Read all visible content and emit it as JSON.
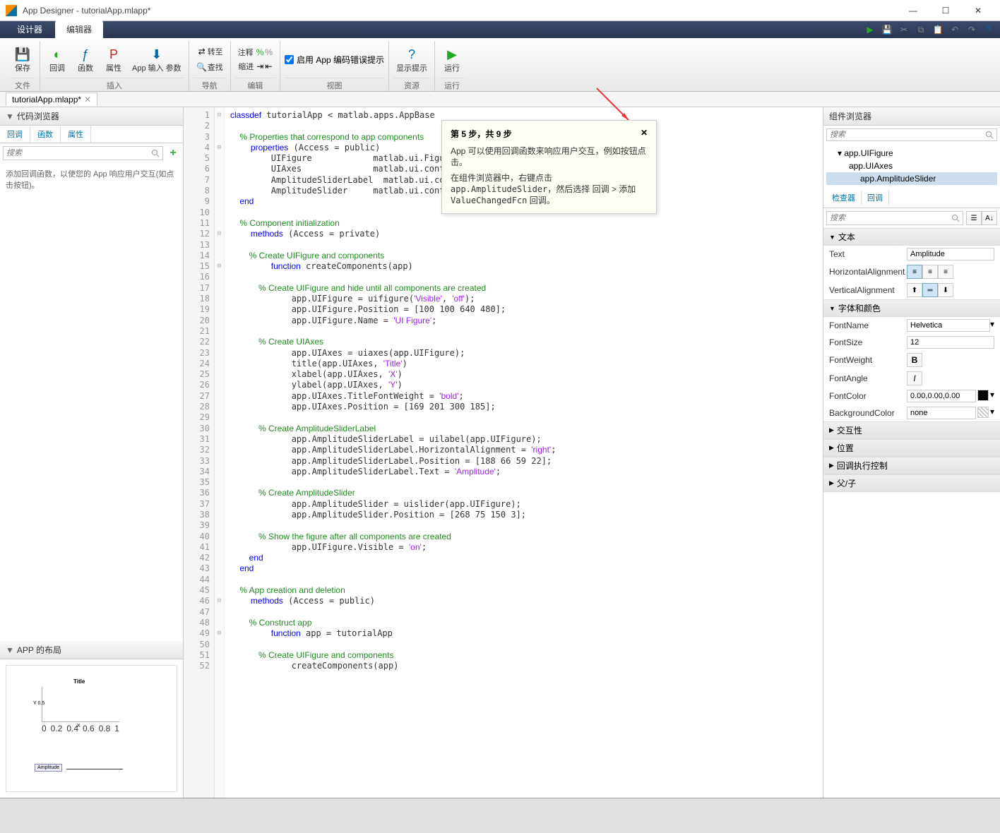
{
  "window": {
    "title": "App Designer - tutorialApp.mlapp*"
  },
  "tabs": {
    "designer": "设计器",
    "editor": "编辑器"
  },
  "ribbon": {
    "save": "保存",
    "callback": "回调",
    "function": "函数",
    "property": "属性",
    "appinput": "App 输入\n参数",
    "goto": "转至",
    "comment": "注释",
    "find": "查找",
    "indent": "缩进",
    "enable_hints": "启用 App 编码错误提示",
    "show_hints": "显示提示",
    "run": "运行",
    "grp_file": "文件",
    "grp_insert": "插入",
    "grp_nav": "导航",
    "grp_edit": "编辑",
    "grp_view": "视图",
    "grp_res": "资源",
    "grp_run": "运行"
  },
  "filetab": "tutorialApp.mlapp*",
  "left": {
    "browser_title": "代码浏览器",
    "tabs": {
      "callback": "回调",
      "function": "函数",
      "property": "属性"
    },
    "search": "搜索",
    "hint": "添加回调函数，以使您的 App 响应用户交互(如点击按钮)。",
    "layout_title": "APP 的布局",
    "mini": {
      "title": "Title",
      "ylabel": "Y 0.5",
      "xlabel": "X",
      "amplitude": "Amplitude",
      "ticks": [
        "0",
        "0.2",
        "0.4",
        "0.6",
        "0.8",
        "1"
      ]
    }
  },
  "code_lines": [
    {
      "n": 1,
      "t": "classdef tutorialApp < matlab.apps.AppBase",
      "cls": ""
    },
    {
      "n": 2,
      "t": "",
      "cls": ""
    },
    {
      "n": 3,
      "t": "    % Properties that correspond to app components",
      "cls": "cmt"
    },
    {
      "n": 4,
      "t": "    properties (Access = public)",
      "cls": ""
    },
    {
      "n": 5,
      "t": "        UIFigure            matlab.ui.Figure",
      "cls": ""
    },
    {
      "n": 6,
      "t": "        UIAxes              matlab.ui.control.UIAxes",
      "cls": ""
    },
    {
      "n": 7,
      "t": "        AmplitudeSliderLabel  matlab.ui.control.Label",
      "cls": ""
    },
    {
      "n": 8,
      "t": "        AmplitudeSlider     matlab.ui.control.Slider",
      "cls": ""
    },
    {
      "n": 9,
      "t": "    end",
      "cls": "kw"
    },
    {
      "n": 10,
      "t": "",
      "cls": ""
    },
    {
      "n": 11,
      "t": "    % Component initialization",
      "cls": "cmt"
    },
    {
      "n": 12,
      "t": "    methods (Access = private)",
      "cls": ""
    },
    {
      "n": 13,
      "t": "",
      "cls": ""
    },
    {
      "n": 14,
      "t": "        % Create UIFigure and components",
      "cls": "cmt"
    },
    {
      "n": 15,
      "t": "        function createComponents(app)",
      "cls": ""
    },
    {
      "n": 16,
      "t": "",
      "cls": ""
    },
    {
      "n": 17,
      "t": "            % Create UIFigure and hide until all components are created",
      "cls": "cmt"
    },
    {
      "n": 18,
      "t": "            app.UIFigure = uifigure('Visible', 'off');",
      "cls": ""
    },
    {
      "n": 19,
      "t": "            app.UIFigure.Position = [100 100 640 480];",
      "cls": ""
    },
    {
      "n": 20,
      "t": "            app.UIFigure.Name = 'UI Figure';",
      "cls": ""
    },
    {
      "n": 21,
      "t": "",
      "cls": ""
    },
    {
      "n": 22,
      "t": "            % Create UIAxes",
      "cls": "cmt"
    },
    {
      "n": 23,
      "t": "            app.UIAxes = uiaxes(app.UIFigure);",
      "cls": ""
    },
    {
      "n": 24,
      "t": "            title(app.UIAxes, 'Title')",
      "cls": ""
    },
    {
      "n": 25,
      "t": "            xlabel(app.UIAxes, 'X')",
      "cls": ""
    },
    {
      "n": 26,
      "t": "            ylabel(app.UIAxes, 'Y')",
      "cls": ""
    },
    {
      "n": 27,
      "t": "            app.UIAxes.TitleFontWeight = 'bold';",
      "cls": ""
    },
    {
      "n": 28,
      "t": "            app.UIAxes.Position = [169 201 300 185];",
      "cls": ""
    },
    {
      "n": 29,
      "t": "",
      "cls": ""
    },
    {
      "n": 30,
      "t": "            % Create AmplitudeSliderLabel",
      "cls": "cmt"
    },
    {
      "n": 31,
      "t": "            app.AmplitudeSliderLabel = uilabel(app.UIFigure);",
      "cls": ""
    },
    {
      "n": 32,
      "t": "            app.AmplitudeSliderLabel.HorizontalAlignment = 'right';",
      "cls": ""
    },
    {
      "n": 33,
      "t": "            app.AmplitudeSliderLabel.Position = [188 66 59 22];",
      "cls": ""
    },
    {
      "n": 34,
      "t": "            app.AmplitudeSliderLabel.Text = 'Amplitude';",
      "cls": ""
    },
    {
      "n": 35,
      "t": "",
      "cls": ""
    },
    {
      "n": 36,
      "t": "            % Create AmplitudeSlider",
      "cls": "cmt"
    },
    {
      "n": 37,
      "t": "            app.AmplitudeSlider = uislider(app.UIFigure);",
      "cls": ""
    },
    {
      "n": 38,
      "t": "            app.AmplitudeSlider.Position = [268 75 150 3];",
      "cls": ""
    },
    {
      "n": 39,
      "t": "",
      "cls": ""
    },
    {
      "n": 40,
      "t": "            % Show the figure after all components are created",
      "cls": "cmt"
    },
    {
      "n": 41,
      "t": "            app.UIFigure.Visible = 'on';",
      "cls": ""
    },
    {
      "n": 42,
      "t": "        end",
      "cls": "kw"
    },
    {
      "n": 43,
      "t": "    end",
      "cls": "kw"
    },
    {
      "n": 44,
      "t": "",
      "cls": ""
    },
    {
      "n": 45,
      "t": "    % App creation and deletion",
      "cls": "cmt"
    },
    {
      "n": 46,
      "t": "    methods (Access = public)",
      "cls": ""
    },
    {
      "n": 47,
      "t": "",
      "cls": ""
    },
    {
      "n": 48,
      "t": "        % Construct app",
      "cls": "cmt"
    },
    {
      "n": 49,
      "t": "        function app = tutorialApp",
      "cls": ""
    },
    {
      "n": 50,
      "t": "",
      "cls": ""
    },
    {
      "n": 51,
      "t": "            % Create UIFigure and components",
      "cls": "cmt"
    },
    {
      "n": 52,
      "t": "            createComponents(app)",
      "cls": ""
    }
  ],
  "tooltip": {
    "step": "第 5 步，共 9 步",
    "body1": "App 可以使用回调函数来响应用户交互，例如按钮点击。",
    "body2a": "在组件浏览器中，右键点击 ",
    "body2b": "app.AmplitudeSlider",
    "body2c": "，然后选择 回调 > 添加 ",
    "body2d": "ValueChangedFcn",
    "body2e": " 回调。"
  },
  "right": {
    "browser_title": "组件浏览器",
    "search": "搜索",
    "tree": {
      "fig": "app.UIFigure",
      "axes": "app.UIAxes",
      "slider": "app.AmplitudeSlider"
    },
    "inspector": "检查器",
    "callback": "回调",
    "sec_text": "文本",
    "text_label": "Text",
    "text_val": "Amplitude",
    "halign_label": "HorizontalAlignment",
    "valign_label": "VerticalAlignment",
    "sec_font": "字体和颜色",
    "fontname_label": "FontName",
    "fontname_val": "Helvetica",
    "fontsize_label": "FontSize",
    "fontsize_val": "12",
    "fontweight_label": "FontWeight",
    "fontangle_label": "FontAngle",
    "fontcolor_label": "FontColor",
    "fontcolor_val": "0.00,0.00,0.00",
    "bgcolor_label": "BackgroundColor",
    "bgcolor_val": "none",
    "sec_inter": "交互性",
    "sec_pos": "位置",
    "sec_cbexec": "回调执行控制",
    "sec_parent": "父/子"
  }
}
